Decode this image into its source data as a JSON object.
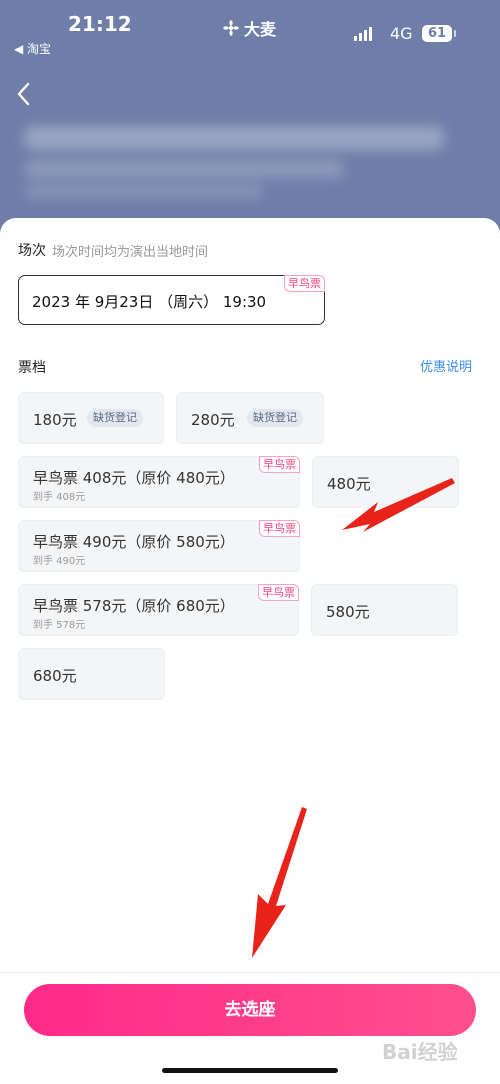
{
  "status_bar": {
    "time": "21:12",
    "back_app": "◀ 淘宝",
    "brand": "大麦",
    "network": "4G",
    "battery": "61"
  },
  "session": {
    "label": "场次",
    "hint": "场次时间均为演出当地时间",
    "value": "2023 年 9月23日 （周六） 19:30",
    "badge": "早鸟票"
  },
  "tiers": {
    "label": "票档",
    "promo_link": "优惠说明",
    "items": [
      {
        "price": "180元",
        "status": "缺货登记"
      },
      {
        "price": "280元",
        "status": "缺货登记"
      },
      {
        "price": "早鸟票 408元（原价 480元）",
        "net": "到手 408元",
        "badge": "早鸟票"
      },
      {
        "price": "480元"
      },
      {
        "price": "早鸟票 490元（原价 580元）",
        "net": "到手 490元",
        "badge": "早鸟票"
      },
      {
        "price": "早鸟票 578元（原价 680元）",
        "net": "到手 578元",
        "badge": "早鸟票"
      },
      {
        "price": "580元"
      },
      {
        "price": "680元"
      }
    ]
  },
  "cta": {
    "label": "去选座"
  },
  "watermark": "Bai经验",
  "colors": {
    "hero": "#6e7ea8",
    "accent_pink": "#ff2a8a",
    "link_blue": "#3d8ee8",
    "arrow_red": "#e8231a"
  }
}
